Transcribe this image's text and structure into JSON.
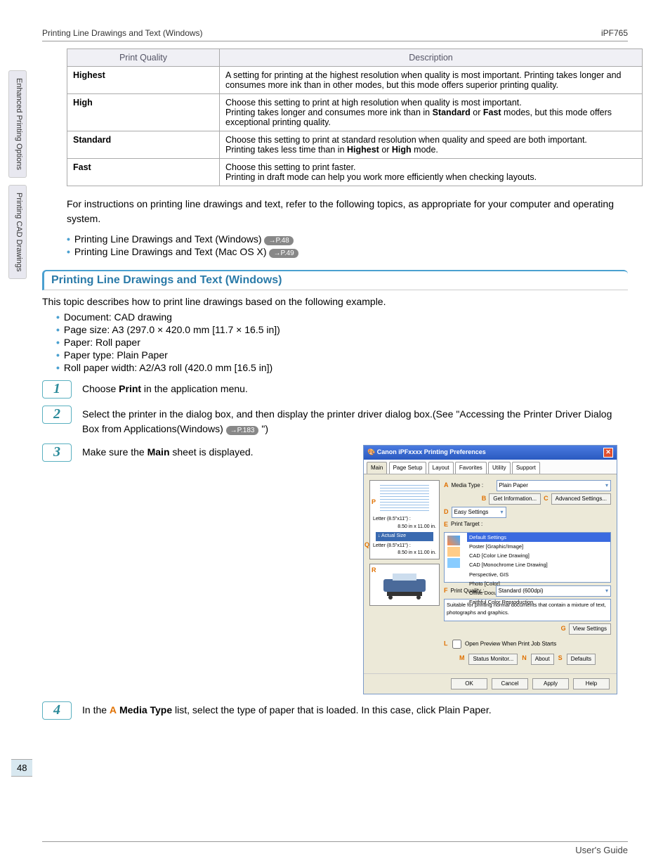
{
  "header": {
    "left": "Printing Line Drawings and Text (Windows)",
    "right": "iPF765"
  },
  "sideTabs": [
    "Enhanced Printing Options",
    "Printing CAD Drawings"
  ],
  "pageNumber": "48",
  "qualityTable": {
    "headers": [
      "Print Quality",
      "Description"
    ],
    "rows": [
      {
        "name": "Highest",
        "desc": "A setting for printing at the highest resolution when quality is most important. Printing takes longer and consumes more ink than in other modes, but this mode offers superior printing quality."
      },
      {
        "name": "High",
        "desc_a": "Choose this setting to print at high resolution when quality is most important.",
        "desc_b_pre": "Printing takes longer and consumes more ink than in ",
        "desc_b_bold1": "Standard",
        "desc_b_mid": " or ",
        "desc_b_bold2": "Fast",
        "desc_b_post": " modes, but this mode offers exceptional printing quality."
      },
      {
        "name": "Standard",
        "desc_a": "Choose this setting to print at standard resolution when quality and speed are both important.",
        "desc_b_pre": "Printing takes less time than in ",
        "desc_b_bold1": "Highest",
        "desc_b_mid": " or ",
        "desc_b_bold2": "High",
        "desc_b_post": " mode."
      },
      {
        "name": "Fast",
        "desc_a": "Choose this setting to print faster.",
        "desc_b": "Printing in draft mode can help you work more efficiently when checking layouts."
      }
    ]
  },
  "intro": "For instructions on printing line drawings and text, refer to the following topics, as appropriate for your computer and operating system.",
  "links": [
    {
      "text": "Printing Line Drawings and Text (Windows)",
      "ref": "→P.48"
    },
    {
      "text": "Printing Line Drawings and Text (Mac OS X)",
      "ref": "→P.49"
    }
  ],
  "sectionTitle": "Printing Line Drawings and Text (Windows)",
  "sectionIntro": "This topic describes how to print line drawings based on the following example.",
  "example": [
    "Document: CAD drawing",
    "Page size: A3 (297.0 × 420.0 mm [11.7 × 16.5 in])",
    "Paper: Roll paper",
    "Paper type: Plain Paper",
    "Roll paper width: A2/A3 roll (420.0 mm [16.5 in])"
  ],
  "steps": {
    "s1_pre": "Choose ",
    "s1_bold": "Print",
    "s1_post": " in the application menu.",
    "s2_a": "Select the printer in the dialog box, and then display the printer driver dialog box.(See \"Accessing the Printer Driver Dialog Box from Applications(Windows) ",
    "s2_ref": "→P.183",
    "s2_b": " \")",
    "s3_pre": "Make sure the ",
    "s3_bold": "Main",
    "s3_post": " sheet is displayed.",
    "s4_pre": "In the ",
    "s4_letter": "A",
    "s4_bold": "Media Type",
    "s4_post": " list, select the type of paper that is loaded. In this case, click Plain Paper."
  },
  "dialog": {
    "title": "Canon iPFxxxx Printing Preferences",
    "tabs": [
      "Main",
      "Page Setup",
      "Layout",
      "Favorites",
      "Utility",
      "Support"
    ],
    "mediaTypeLabel": "Media Type :",
    "mediaType": "Plain Paper",
    "getInfo": "Get Information...",
    "advSettings": "Advanced Settings...",
    "easyLabel": "Easy Settings",
    "printTargetLabel": "Print Target :",
    "targets": [
      "Default Settings",
      "Poster [Graphic/Image]",
      "CAD [Color Line Drawing]",
      "CAD [Monochrome Line Drawing]",
      "Perspective, GIS",
      "Photo [Color]",
      "Office Document",
      "Faithful Color Reproduction"
    ],
    "printQualityLabel": "Print Quality :",
    "printQuality": "Standard (600dpi)",
    "desc": "Suitable for printing normal documents that contain a mixture of text, photographs and graphics.",
    "viewSettings": "View Settings",
    "openPreview": "Open Preview When Print Job Starts",
    "statusMonitor": "Status Monitor...",
    "about": "About",
    "defaults": "Defaults",
    "ok": "OK",
    "cancel": "Cancel",
    "apply": "Apply",
    "help": "Help",
    "preview": {
      "letter1": "Letter (8.5\"x11\") :",
      "dim": "8.50 in x 11.00 in.",
      "actual": "↓  Actual Size",
      "letter2": "Letter (8.5\"x11\") :"
    }
  },
  "footer": "User's Guide"
}
